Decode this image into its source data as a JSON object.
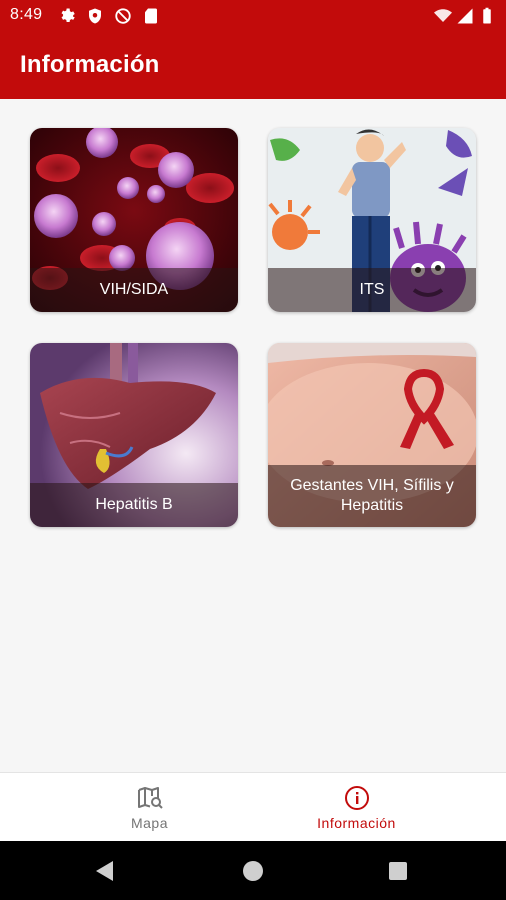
{
  "status_bar": {
    "time": "8:49",
    "left_icons": [
      "gear-icon",
      "shield-icon",
      "no-disturb-icon",
      "sd-card-icon"
    ],
    "right_icons": [
      "wifi-icon",
      "signal-icon",
      "battery-icon"
    ]
  },
  "app_bar": {
    "title": "Información",
    "color": "#c20b0b"
  },
  "cards": [
    {
      "label": "VIH/SIDA",
      "icon": "virus-image"
    },
    {
      "label": "ITS",
      "icon": "bacteria-person-image"
    },
    {
      "label": "Hepatitis B",
      "icon": "liver-image"
    },
    {
      "label": "Gestantes VIH, Sífilis y Hepatitis",
      "icon": "pregnant-ribbon-image"
    }
  ],
  "bottom_nav": {
    "items": [
      {
        "label": "Mapa",
        "icon": "map-search-icon",
        "active": false
      },
      {
        "label": "Información",
        "icon": "info-icon",
        "active": true
      }
    ],
    "active_color": "#c20b0b",
    "inactive_color": "#757575"
  },
  "system_nav": {
    "buttons": [
      "back-icon",
      "home-icon",
      "recents-icon"
    ]
  }
}
